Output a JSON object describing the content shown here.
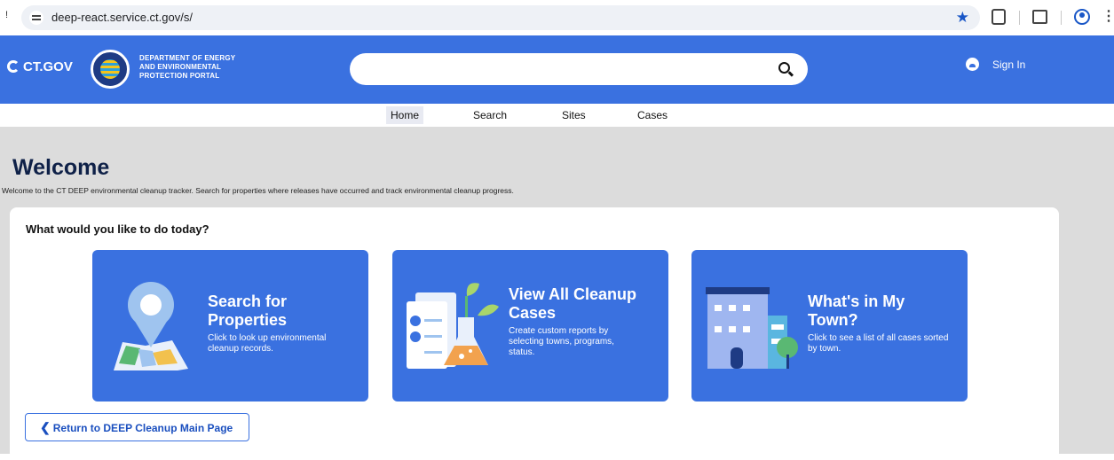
{
  "browser": {
    "url": "deep-react.service.ct.gov/s/",
    "left_glyph": "!"
  },
  "header": {
    "ct_logo": "CT.GOV",
    "dept_line1": "DEPARTMENT OF ENERGY",
    "dept_line2": "AND ENVIRONMENTAL",
    "dept_line3": "PROTECTION PORTAL",
    "search_placeholder": "",
    "sign_in": "Sign In"
  },
  "nav": {
    "items": [
      "Home",
      "Search",
      "Sites",
      "Cases"
    ],
    "active": "Home"
  },
  "welcome": {
    "title": "Welcome",
    "subtitle": "Welcome to the CT DEEP environmental cleanup tracker. Search for properties where releases have occurred and track environmental cleanup progress."
  },
  "main": {
    "prompt": "What would you like to do today?",
    "cards": [
      {
        "title_line1": "Search for",
        "title_line2": "Properties",
        "desc": "Click to look up environmental cleanup records.",
        "icon": "map-pin-icon"
      },
      {
        "title_line1": "View All Cleanup",
        "title_line2": "Cases",
        "desc": "Create custom reports by selecting towns, programs, status.",
        "icon": "lab-report-icon"
      },
      {
        "title_line1": "What's in My",
        "title_line2": "Town?",
        "desc": "Click to see a list of all cases sorted by town.",
        "icon": "town-buildings-icon"
      }
    ],
    "return_button": "Return to DEEP Cleanup Main Page"
  },
  "colors": {
    "brand_blue": "#3a71e0",
    "heading_navy": "#0f2148",
    "page_grey": "#dcdcdc"
  }
}
